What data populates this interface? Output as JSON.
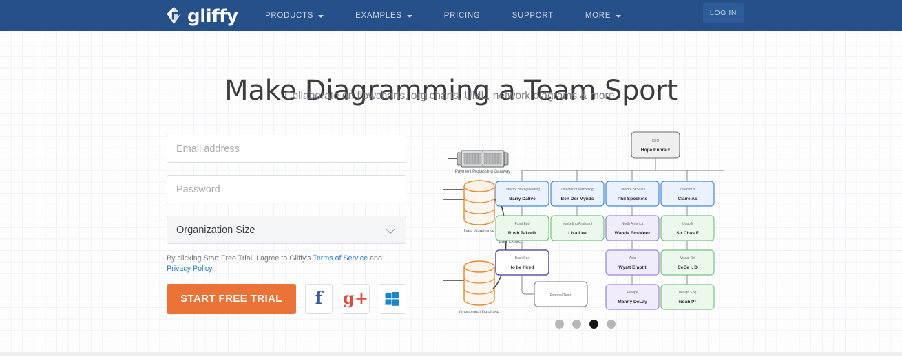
{
  "header": {
    "logo_text": "gliffy",
    "logo_icon": "gliffy-diamond-logo",
    "nav": [
      {
        "label": "PRODUCTS",
        "has_caret": true
      },
      {
        "label": "EXAMPLES",
        "has_caret": true
      },
      {
        "label": "PRICING",
        "has_caret": false
      },
      {
        "label": "SUPPORT",
        "has_caret": false
      },
      {
        "label": "MORE",
        "has_caret": true
      }
    ],
    "login_label": "LOG IN",
    "bg_color": "#255089",
    "login_bg_color": "#2d5c99"
  },
  "hero": {
    "headline": "Make Diagramming a Team Sport",
    "subheadline": "Collaborate on flowcharts, org charts, UML, network diagrams & more."
  },
  "form": {
    "email_placeholder": "Email address",
    "email_value": "",
    "password_placeholder": "Password",
    "password_value": "",
    "org_size_selected": "Organization Size",
    "terms_prefix": "By clicking Start Free Trial, I agree to Gliffy's ",
    "terms_link": "Terms of Service",
    "terms_middle": " and ",
    "privacy_link": "Privacy Policy",
    "terms_suffix": ".",
    "cta_label": "START FREE TRIAL",
    "cta_color": "#ec7338",
    "social": [
      {
        "name": "facebook",
        "glyph": "f",
        "color": "#3b5998"
      },
      {
        "name": "google-plus",
        "glyph": "g+",
        "color": "#d94c3d"
      },
      {
        "name": "windows",
        "glyph": "",
        "color": "#1b86c8"
      }
    ]
  },
  "illustration": {
    "network": {
      "server_label": "Payment Processing Gateway",
      "warehouse_label": "Data Warehouse",
      "operational_label": "Operational Database",
      "edge_label": "Data Extract"
    },
    "orgchart": {
      "ceo": {
        "title": "CEO",
        "name": "Hope Enpraix",
        "color": "#efefef"
      },
      "columns": [
        {
          "director": {
            "title": "Director of Engineering",
            "name": "Barry Dalive"
          },
          "reports": [
            {
              "title": "Front End",
              "name": "Rush Takodit",
              "color": "green"
            },
            {
              "title": "Back End",
              "name": "to be hired",
              "color": "outline-purple"
            },
            {
              "title": "",
              "name": "External Team",
              "color": "plain"
            }
          ]
        },
        {
          "director": {
            "title": "Director of Marketing",
            "name": "Ben Der Mynds"
          },
          "reports": [
            {
              "title": "Marketing Assistant",
              "name": "Lisa Lee",
              "color": "green"
            }
          ]
        },
        {
          "director": {
            "title": "Director of Sales",
            "name": "Phil Spockets"
          },
          "reports": [
            {
              "title": "North America",
              "name": "Wanda Em-Moor",
              "color": "purple"
            },
            {
              "title": "Asia",
              "name": "Wyatt Emptit",
              "color": "purple"
            },
            {
              "title": "Europe",
              "name": "Manny DeLay",
              "color": "purple"
            }
          ]
        },
        {
          "director": {
            "title": "Director o",
            "name": "Claire As"
          },
          "reports": [
            {
              "title": "Usabili",
              "name": "Sir Chas F",
              "color": "green"
            },
            {
              "title": "Visual De",
              "name": "CeCe I. D",
              "color": "green"
            },
            {
              "title": "Design Eng",
              "name": "Noah Pr",
              "color": "green"
            }
          ]
        }
      ]
    }
  },
  "carousel": {
    "dots": [
      {
        "active": false
      },
      {
        "active": false
      },
      {
        "active": true
      },
      {
        "active": false
      }
    ]
  }
}
